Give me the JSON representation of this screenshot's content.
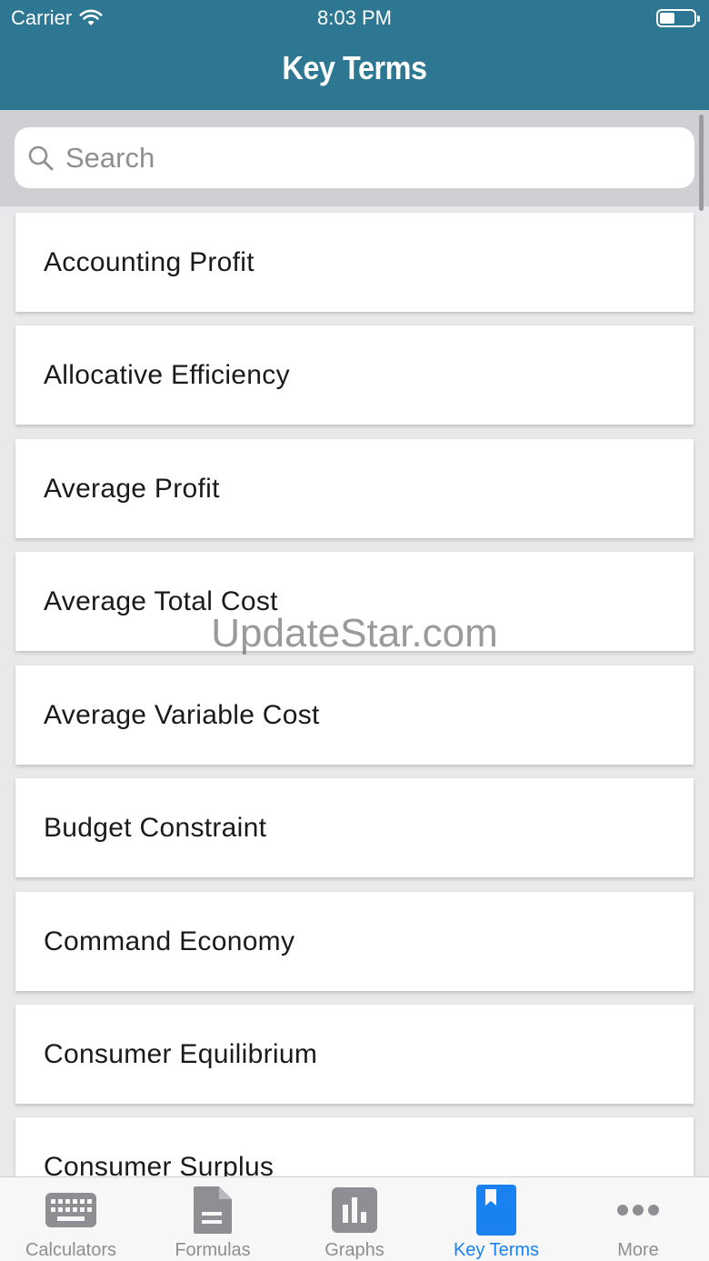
{
  "status_bar": {
    "carrier": "Carrier",
    "time": "8:03 PM"
  },
  "header": {
    "title": "Key Terms"
  },
  "search": {
    "placeholder": "Search",
    "value": ""
  },
  "terms": [
    "Accounting Profit",
    "Allocative Efficiency",
    "Average Profit",
    "Average Total Cost",
    "Average Variable Cost",
    "Budget Constraint",
    "Command Economy",
    "Consumer Equilibrium",
    "Consumer Surplus"
  ],
  "watermark": "UpdateStar.com",
  "tabbar": {
    "tabs": [
      {
        "label": "Calculators",
        "icon": "keyboard-icon"
      },
      {
        "label": "Formulas",
        "icon": "document-icon"
      },
      {
        "label": "Graphs",
        "icon": "bar-chart-icon"
      },
      {
        "label": "Key Terms",
        "icon": "bookmark-icon"
      },
      {
        "label": "More",
        "icon": "more-dots-icon"
      }
    ],
    "active_index": 3
  },
  "colors": {
    "header": "#2e7792",
    "active_tab": "#1a82f0",
    "inactive_tab": "#8e8e93"
  }
}
